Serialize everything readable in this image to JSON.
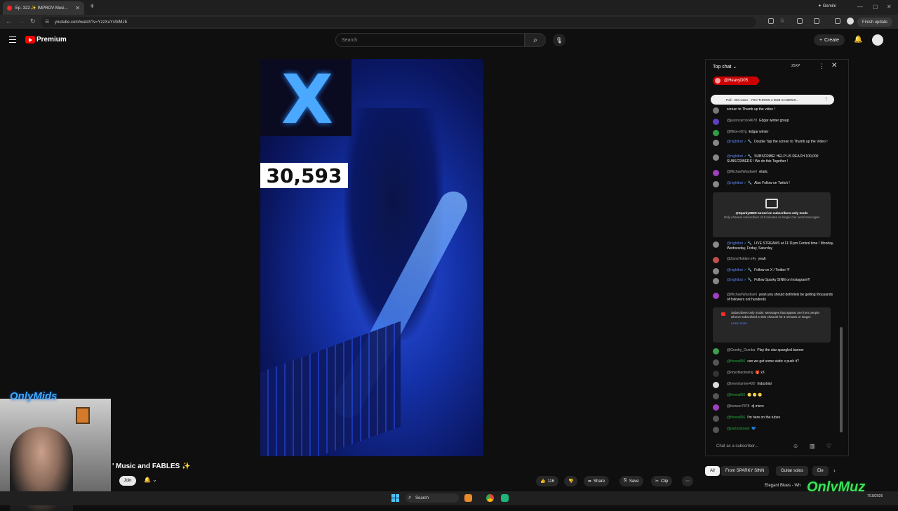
{
  "browser": {
    "tab_title": "Ep. 322 ✨ IMPROV Musi...",
    "new_tab": "+",
    "gemini": "✦ Gemini",
    "url": "youtube.com/watch?v=YzzXuYsWMJE",
    "finish_update": "Finish update"
  },
  "youtube": {
    "brand": "Premium",
    "search_placeholder": "Search",
    "create_label": "Create"
  },
  "video": {
    "counter": "30,593",
    "title": "' Music and FABLES ✨",
    "join_label": "Join",
    "actions": {
      "likes": "116",
      "share": "Share",
      "save": "Save",
      "clip": "Clip"
    }
  },
  "chat": {
    "header": "Top chat",
    "xp": "25XP",
    "pinned_user": "@HeavyD05",
    "poll": "Poll · 294 votes · YOU THROW A DUB SANDWIC...",
    "messages": [
      {
        "author": "",
        "text": "screen to Thumb up the video !",
        "style": "plain",
        "color": "#777777"
      },
      {
        "author": "@jasoncarrico4678",
        "text": "Edgar winter group",
        "style": "auth",
        "color": "#5e3fbf"
      },
      {
        "author": "@Mike-e87g",
        "text": "Edgar winter",
        "style": "auth",
        "color": "#2f9f4a"
      },
      {
        "author": "@nightbot",
        "text": "Double Tap the screen to Thumb up the Video !",
        "style": "mod",
        "color": "#888888"
      },
      {
        "author": "@nightbot",
        "text": "SUBSCRIBE! HELP US REACH 100,000 SUBSCRIBERS ! We do this Together !",
        "style": "mod",
        "color": "#888888"
      },
      {
        "author": "@MichaelWardwell",
        "text": "vitalic",
        "style": "auth",
        "color": "#a03fbf"
      },
      {
        "author": "@nightbot",
        "text": "Also Follow on Twitch !",
        "style": "mod",
        "color": "#888888"
      },
      {
        "author": "@nightbot",
        "text": "LIVE STREAMS at 11:11pm Central time ! Monday, Wednesday, Friday, Saturday",
        "style": "mod",
        "color": "#888888"
      },
      {
        "author": "@ZaneHolden-z4y",
        "text": "yeah",
        "style": "auth",
        "color": "#c0504a"
      },
      {
        "author": "@nightbot",
        "text": "Follow on X / Twitter !!!",
        "style": "mod",
        "color": "#888888"
      },
      {
        "author": "@nightbot",
        "text": "Follow Sparky SINN on Instagram!!!",
        "style": "mod",
        "color": "#888888"
      },
      {
        "author": "@MichaelWardwell",
        "text": "yeah you should definitely be getting thousands of followers not hundreds",
        "style": "auth",
        "color": "#a03fbf"
      },
      {
        "author": "@Gumby_Gumba",
        "text": "Play the star spangled banner",
        "style": "auth",
        "color": "#3fa04a"
      },
      {
        "author": "@firewall56",
        "text": "can we get some static x push it?",
        "style": "grn",
        "color": "#555555"
      },
      {
        "author": "@onyxblackwing",
        "text": "🎁 x3",
        "style": "auth",
        "color": "#333333"
      },
      {
        "author": "@trevortanner420",
        "text": "Industrial",
        "style": "auth",
        "color": "#dddddd"
      },
      {
        "author": "@firewall56",
        "text": "😁 😁 😁",
        "style": "grn",
        "color": "#555555"
      },
      {
        "author": "@bowser7878",
        "text": "dj micro",
        "style": "auth",
        "color": "#a03fbf"
      },
      {
        "author": "@firewall56",
        "text": "I'm here on the tubes",
        "style": "grn",
        "color": "#555555"
      },
      {
        "author": "@particleband",
        "text": "💙",
        "style": "grn",
        "color": "#555555"
      }
    ],
    "notice_subs": {
      "line1": "@SparkySINN turned on subscribers-only mode",
      "line2": "Only channel subscribers of 5 minutes or longer can send messages"
    },
    "notice_info": {
      "text": "Subscribers-only mode. Messages that appear are from people who've subscribed to this channel for 5 minutes or longer.",
      "link": "Learn more"
    },
    "input_placeholder": "Chat as a subscriber..."
  },
  "chips": [
    "All",
    "From SPARKY SINN",
    "Guitar solos",
    "Ele"
  ],
  "related": "Elegant Blues - Wh",
  "overlays": {
    "onlymids": "OnlyMids",
    "onlymuz": "OnlyMuz"
  },
  "taskbar": {
    "search": "Search",
    "time": "",
    "date": "7/18/2026"
  },
  "colors": {
    "yt_red": "#ff0000",
    "chip_active": "#f1f1f1",
    "mod_blue": "#5e84f1"
  }
}
